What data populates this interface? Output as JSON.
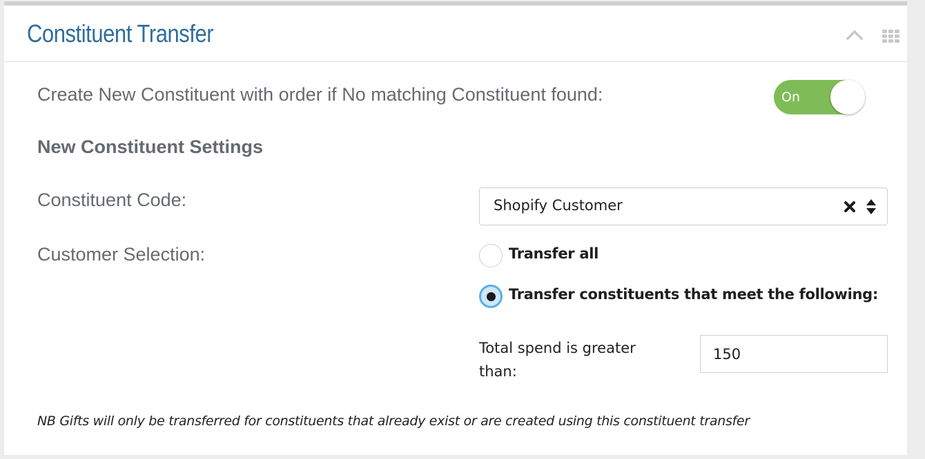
{
  "panel": {
    "title": "Constituent Transfer",
    "icons": {
      "collapse": "chevron-up-icon",
      "drag": "grid-icon"
    }
  },
  "create_new": {
    "label": "Create New Constituent with order if No matching Constituent found:",
    "toggle_label": "On",
    "toggle_state": true,
    "toggle_color": "#7fbc57"
  },
  "settings": {
    "heading": "New Constituent Settings",
    "constituent_code": {
      "label": "Constituent Code:",
      "selected_value": "Shopify Customer",
      "icons": [
        "clear-icon",
        "sort-icon"
      ]
    },
    "customer_selection": {
      "label": "Customer Selection:",
      "options": [
        {
          "label": "Transfer all",
          "checked": false
        },
        {
          "label": "Transfer constituents that meet the following:",
          "checked": true
        }
      ],
      "total_spend": {
        "label": "Total spend is greater than:",
        "value": "150"
      }
    }
  },
  "footnote": "NB Gifts will only be transferred for constituents that already exist or are created using this constituent transfer",
  "colors": {
    "title": "#2f6d9c",
    "radio_focus": "#5aaee5"
  }
}
